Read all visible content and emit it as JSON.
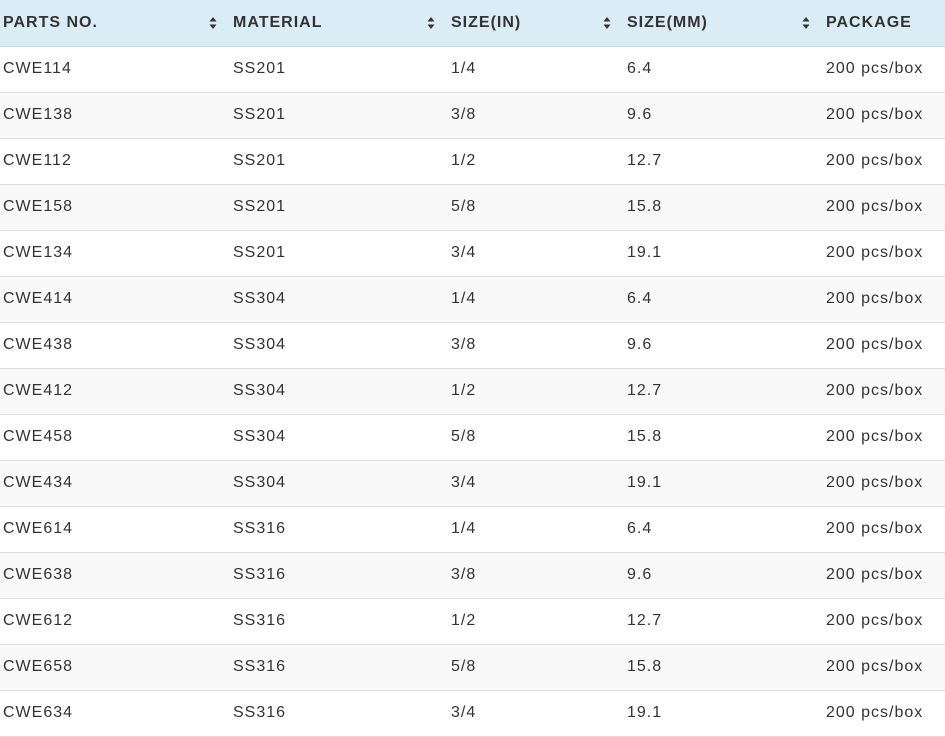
{
  "table": {
    "headers": [
      "PARTS NO.",
      "MATERIAL",
      "SIZE(IN)",
      "SIZE(MM)",
      "PACKAGE"
    ],
    "sortable": [
      true,
      true,
      true,
      true,
      false
    ],
    "rows": [
      [
        "CWE114",
        "SS201",
        "1/4",
        "6.4",
        "200 pcs/box"
      ],
      [
        "CWE138",
        "SS201",
        "3/8",
        "9.6",
        "200 pcs/box"
      ],
      [
        "CWE112",
        "SS201",
        "1/2",
        "12.7",
        "200 pcs/box"
      ],
      [
        "CWE158",
        "SS201",
        "5/8",
        "15.8",
        "200 pcs/box"
      ],
      [
        "CWE134",
        "SS201",
        "3/4",
        "19.1",
        "200 pcs/box"
      ],
      [
        "CWE414",
        "SS304",
        "1/4",
        "6.4",
        "200 pcs/box"
      ],
      [
        "CWE438",
        "SS304",
        "3/8",
        "9.6",
        "200 pcs/box"
      ],
      [
        "CWE412",
        "SS304",
        "1/2",
        "12.7",
        "200 pcs/box"
      ],
      [
        "CWE458",
        "SS304",
        "5/8",
        "15.8",
        "200 pcs/box"
      ],
      [
        "CWE434",
        "SS304",
        "3/4",
        "19.1",
        "200 pcs/box"
      ],
      [
        "CWE614",
        "SS316",
        "1/4",
        "6.4",
        "200 pcs/box"
      ],
      [
        "CWE638",
        "SS316",
        "3/8",
        "9.6",
        "200 pcs/box"
      ],
      [
        "CWE612",
        "SS316",
        "1/2",
        "12.7",
        "200 pcs/box"
      ],
      [
        "CWE658",
        "SS316",
        "5/8",
        "15.8",
        "200 pcs/box"
      ],
      [
        "CWE634",
        "SS316",
        "3/4",
        "19.1",
        "200 pcs/box"
      ]
    ]
  },
  "colors": {
    "header_bg": "#daedf7",
    "row_alt_bg": "#f9f9f9",
    "text": "#333333",
    "divider": "#dddddd"
  },
  "icons": {
    "sort": "sort-icon"
  }
}
